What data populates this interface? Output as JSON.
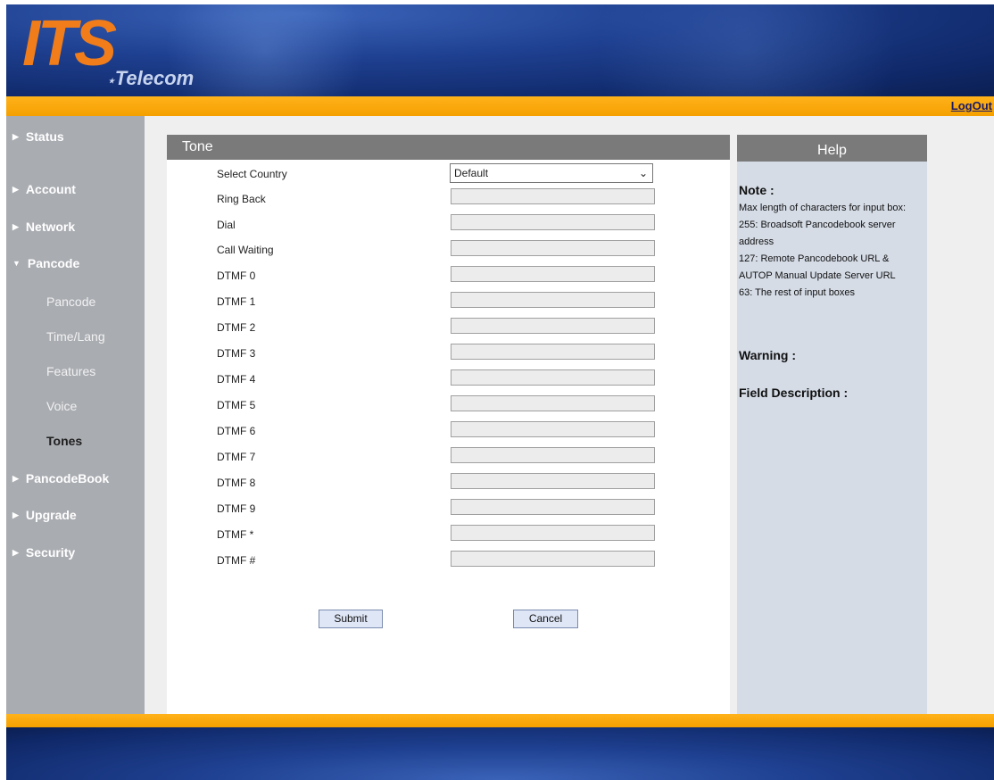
{
  "brand": {
    "logo_main": "ITS",
    "logo_sub": "Telecom"
  },
  "header": {
    "logout_label": "LogOut"
  },
  "sidebar": {
    "items": [
      {
        "label": "Status"
      },
      {
        "label": "Account"
      },
      {
        "label": "Network"
      },
      {
        "label": "Pancode"
      },
      {
        "label": "PancodeBook"
      },
      {
        "label": "Upgrade"
      },
      {
        "label": "Security"
      }
    ],
    "pancode_sub": [
      {
        "label": "Pancode"
      },
      {
        "label": "Time/Lang"
      },
      {
        "label": "Features"
      },
      {
        "label": "Voice"
      },
      {
        "label": "Tones"
      }
    ]
  },
  "tone": {
    "title": "Tone",
    "country_label": "Select Country",
    "country_value": "Default",
    "rows": [
      {
        "label": "Ring Back",
        "value": ""
      },
      {
        "label": "Dial",
        "value": ""
      },
      {
        "label": "Call Waiting",
        "value": ""
      },
      {
        "label": "DTMF 0",
        "value": ""
      },
      {
        "label": "DTMF 1",
        "value": ""
      },
      {
        "label": "DTMF 2",
        "value": ""
      },
      {
        "label": "DTMF 3",
        "value": ""
      },
      {
        "label": "DTMF 4",
        "value": ""
      },
      {
        "label": "DTMF 5",
        "value": ""
      },
      {
        "label": "DTMF 6",
        "value": ""
      },
      {
        "label": "DTMF 7",
        "value": ""
      },
      {
        "label": "DTMF 8",
        "value": ""
      },
      {
        "label": "DTMF 9",
        "value": ""
      },
      {
        "label": "DTMF *",
        "value": ""
      },
      {
        "label": "DTMF #",
        "value": ""
      }
    ],
    "submit_label": "Submit",
    "cancel_label": "Cancel"
  },
  "help": {
    "title": "Help",
    "note_title": "Note :",
    "note_lines": [
      "Max length of characters for input box:",
      "255: Broadsoft Pancodebook server address",
      "127: Remote Pancodebook URL & AUTOP Manual Update Server URL",
      "63: The rest of input boxes"
    ],
    "warning_title": "Warning :",
    "field_desc_title": "Field Description :"
  },
  "colors": {
    "accent_orange": "#f5a000",
    "header_blue": "#1e3f8f",
    "sidebar_grey": "#a9acb1",
    "section_grey": "#7a7a7a"
  }
}
